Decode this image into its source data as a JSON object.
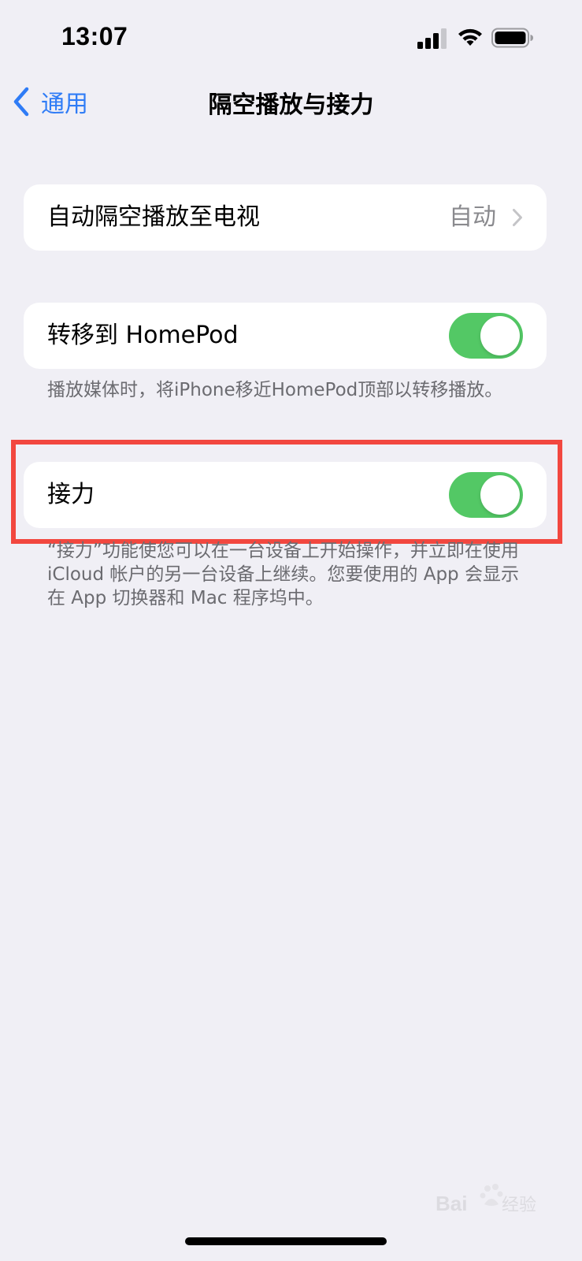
{
  "status_bar": {
    "time": "13:07",
    "signal_icon": "cellular-signal-icon",
    "wifi_icon": "wifi-icon",
    "battery_icon": "battery-icon"
  },
  "nav": {
    "back_label": "通用",
    "back_icon": "chevron-left-icon",
    "title": "隔空播放与接力"
  },
  "airplay_row": {
    "label": "自动隔空播放至电视",
    "value": "自动",
    "chevron_icon": "chevron-right-icon"
  },
  "homepod_row": {
    "label": "转移到 HomePod",
    "toggle_on": true,
    "footnote": "播放媒体时，将iPhone移近HomePod顶部以转移播放。"
  },
  "handoff_row": {
    "label": "接力",
    "toggle_on": true,
    "footnote": "“接力”功能使您可以在一台设备上开始操作，并立即在使用 iCloud 帐户的另一台设备上继续。您要使用的 App 会显示在 App 切换器和 Mac 程序坞中。"
  },
  "colors": {
    "background": "#f0eff5",
    "accent": "#2f7cf6",
    "toggle_on": "#53c865",
    "highlight": "#f2473f"
  },
  "watermark": {
    "text": "Baidu 经验"
  }
}
